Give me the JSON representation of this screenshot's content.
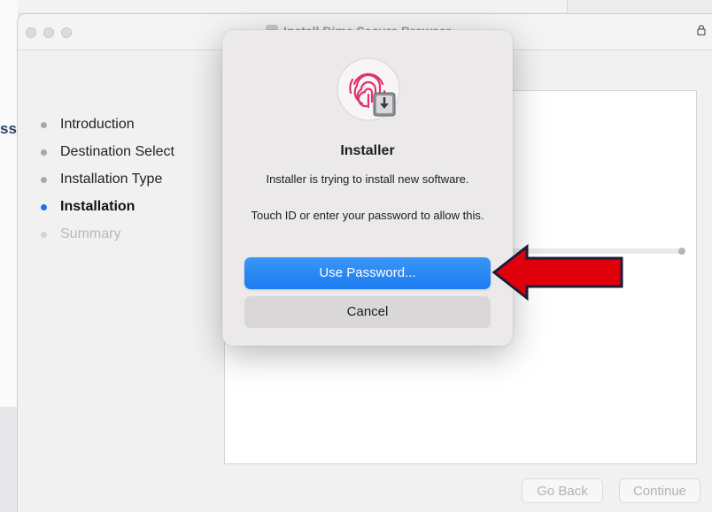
{
  "background": {
    "left_text_fragment": "ss"
  },
  "window": {
    "title": "Install Dime Secure Browser",
    "lock_icon": "lock-icon"
  },
  "steps": [
    {
      "label": "Introduction",
      "state": "done"
    },
    {
      "label": "Destination Select",
      "state": "done"
    },
    {
      "label": "Installation Type",
      "state": "done"
    },
    {
      "label": "Installation",
      "state": "active"
    },
    {
      "label": "Summary",
      "state": "pending"
    }
  ],
  "footer": {
    "back_label": "Go Back",
    "continue_label": "Continue"
  },
  "dialog": {
    "icon": "touch-id-installer-icon",
    "title": "Installer",
    "message": "Installer is trying to install new software.",
    "hint": "Touch ID or enter your password to allow this.",
    "primary_label": "Use Password...",
    "secondary_label": "Cancel"
  },
  "annotation": {
    "arrow_color": "#e0000a",
    "arrow_outline": "#1b1b3a"
  },
  "colors": {
    "accent": "#1c7cf0",
    "active_step_dot": "#1a73e8"
  }
}
